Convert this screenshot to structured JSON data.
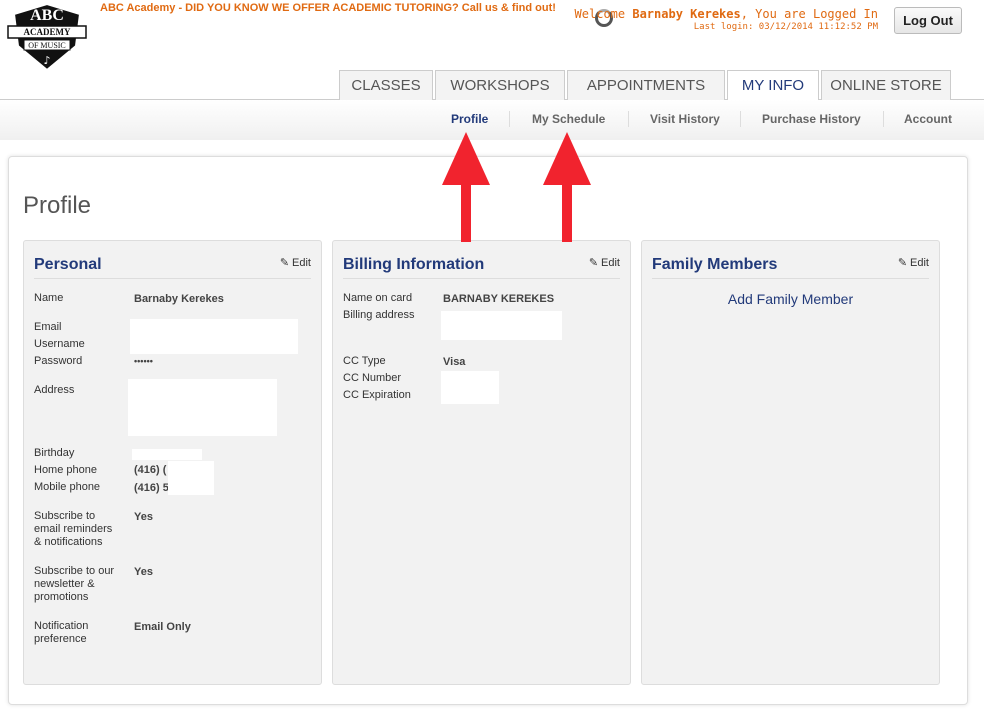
{
  "header": {
    "logo_text_top": "ABC",
    "logo_text_band": "ACADEMY",
    "logo_text_bottom": "OF MUSIC",
    "promo": "ABC Academy - DID YOU KNOW WE OFFER ACADEMIC TUTORING? Call us & find out!",
    "welcome_prefix": "Welcome ",
    "user_name": "Barnaby Kerekes",
    "welcome_suffix": ", You are Logged In",
    "last_login": "Last login: 03/12/2014 11:12:52 PM",
    "logout_label": "Log Out"
  },
  "tabs": [
    "CLASSES",
    "WORKSHOPS",
    "APPOINTMENTS",
    "MY INFO",
    "ONLINE STORE"
  ],
  "subnav": [
    "Profile",
    "My Schedule",
    "Visit History",
    "Purchase History",
    "Account"
  ],
  "page_title": "Profile",
  "personal": {
    "title": "Personal",
    "edit": "Edit",
    "name_label": "Name",
    "name_value": "Barnaby Kerekes",
    "email_label": "Email",
    "username_label": "Username",
    "password_label": "Password",
    "password_value": "••••••",
    "address_label": "Address",
    "birthday_label": "Birthday",
    "home_phone_label": "Home phone",
    "home_phone_value": "(416) (",
    "mobile_phone_label": "Mobile phone",
    "mobile_phone_value": "(416) 5",
    "subscribe_reminders_label": [
      "Subscribe to",
      "email reminders",
      "& notifications"
    ],
    "subscribe_reminders_value": "Yes",
    "subscribe_newsletter_label": [
      "Subscribe to our",
      "newsletter &",
      "promotions"
    ],
    "subscribe_newsletter_value": "Yes",
    "notification_label": [
      "Notification",
      "preference"
    ],
    "notification_value": "Email Only"
  },
  "billing": {
    "title": "Billing Information",
    "edit": "Edit",
    "name_on_card_label": "Name on card",
    "name_on_card_value": "BARNABY KEREKES",
    "billing_address_label": "Billing address",
    "cc_type_label": "CC Type",
    "cc_type_value": "Visa",
    "cc_number_label": "CC Number",
    "cc_expiration_label": "CC Expiration"
  },
  "family": {
    "title": "Family Members",
    "edit": "Edit",
    "add_link": "Add Family Member"
  },
  "colors": {
    "accent_orange": "#e06a12",
    "navy": "#223a7a",
    "arrow_red": "#f1232e"
  }
}
